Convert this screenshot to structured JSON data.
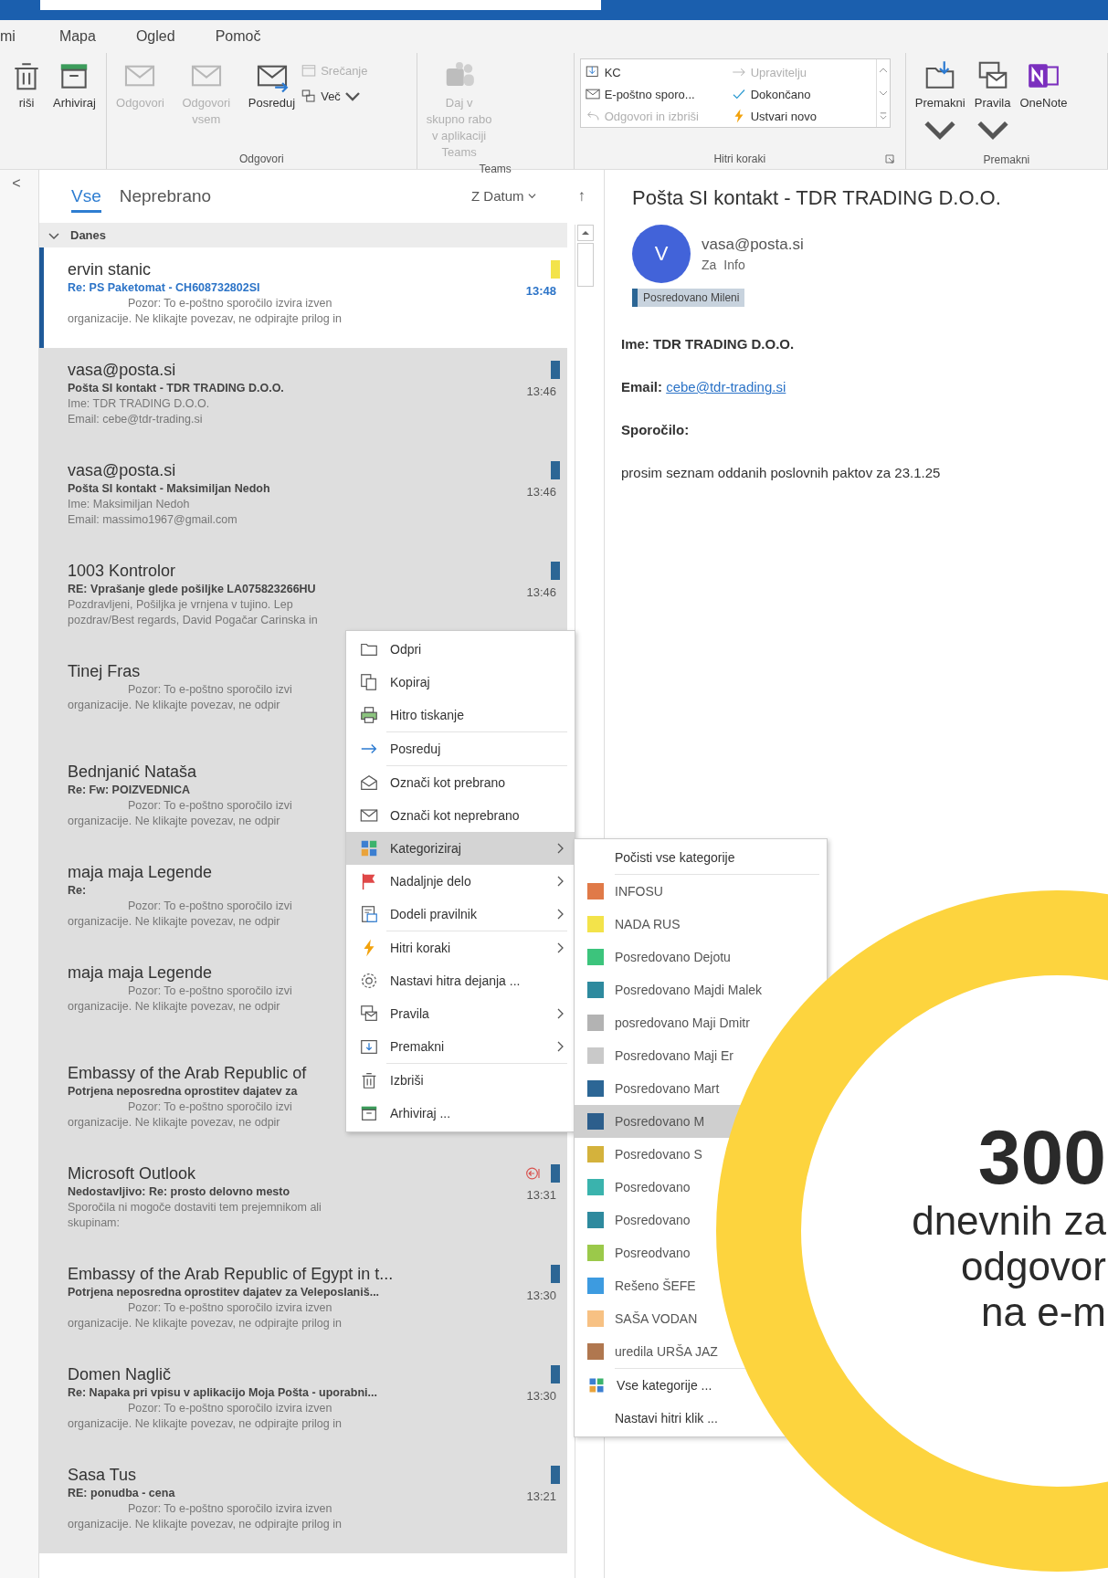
{
  "menu_bar": {
    "items": [
      "mi",
      "Mapa",
      "Ogled",
      "Pomoč"
    ]
  },
  "ribbon": {
    "groups": [
      {
        "buttons": [
          {
            "label": "riši",
            "kind": "large",
            "disabled": false
          },
          {
            "label": "Arhiviraj",
            "kind": "large",
            "disabled": false
          }
        ]
      },
      {
        "label": "Odgovori",
        "buttons": [
          {
            "label": "Odgovori",
            "kind": "large",
            "disabled": true
          },
          {
            "label": "Odgovori vsem",
            "kind": "large",
            "disabled": true
          },
          {
            "label": "Posreduj",
            "kind": "large",
            "disabled": false
          },
          {
            "label": "Srečanje",
            "kind": "small",
            "disabled": true
          },
          {
            "label": "Več",
            "kind": "small",
            "disabled": false,
            "menu": true
          }
        ]
      },
      {
        "label": "Teams",
        "buttons": [
          {
            "label": "Daj v skupno rabo v aplikaciji Teams",
            "kind": "large",
            "disabled": true
          }
        ]
      },
      {
        "label": "Hitri koraki",
        "launcher": true,
        "gallery": [
          {
            "label": "KC",
            "disabled": false
          },
          {
            "label": "E-poštno sporo...",
            "disabled": false
          },
          {
            "label": "Odgovori in izbriši",
            "disabled": true
          },
          {
            "label": "Upravitelju",
            "disabled": true
          },
          {
            "label": "Dokončano",
            "disabled": false
          },
          {
            "label": "Ustvari novo",
            "disabled": false
          }
        ]
      },
      {
        "label": "Premakni",
        "buttons": [
          {
            "label": "Premakni",
            "kind": "large",
            "disabled": false,
            "menu": true
          },
          {
            "label": "Pravila",
            "kind": "large",
            "disabled": false,
            "menu": true
          },
          {
            "label": "OneNote",
            "kind": "large",
            "disabled": false
          }
        ]
      }
    ]
  },
  "nav": {
    "collapse": "<"
  },
  "mail_list": {
    "tabs": [
      {
        "label": "Vse",
        "selected": true
      },
      {
        "label": "Neprebrano",
        "selected": false
      }
    ],
    "sort": "Z Datum",
    "sort_direction": "↑",
    "group": "Danes",
    "items": [
      {
        "sender": "ervin stanic",
        "subject": "Re: PS Paketomat - CH608732802SI",
        "preview": [
          "Pozor: To e-poštno sporočilo izvira izven",
          "organizacije. Ne klikajte povezav, ne odpirajte prilog in"
        ],
        "indented": true,
        "time": "13:48",
        "color": "#f3e34a",
        "selected": true
      },
      {
        "sender": "vasa@posta.si",
        "subject": "Pošta SI kontakt - TDR TRADING D.O.O.",
        "preview": [
          "Ime: TDR TRADING D.O.O.",
          "Email: cebe@tdr-trading.si"
        ],
        "indented": false,
        "time": "13:46",
        "color": "#2c6695",
        "selected": false
      },
      {
        "sender": "vasa@posta.si",
        "subject": "Pošta SI kontakt - Maksimiljan Nedoh",
        "preview": [
          "Ime: Maksimiljan Nedoh",
          "Email: massimo1967@gmail.com"
        ],
        "indented": false,
        "time": "13:46",
        "color": "#2c6695",
        "selected": false
      },
      {
        "sender": "1003 Kontrolor",
        "subject": "RE: Vprašanje glede pošiljke LA075823266HU",
        "preview": [
          "Pozdravljeni,  Pošiljka je vrnjena v tujino.  Lep",
          "pozdrav/Best regards,  David Pogačar  Carinska in"
        ],
        "indented": false,
        "time": "13:46",
        "color": "#2c6695",
        "selected": false
      },
      {
        "sender": "Tinej Fras",
        "preview": [
          "Pozor: To e-poštno sporočilo izvi",
          "organizacije. Ne klikajte povezav, ne odpir"
        ],
        "indented": true,
        "selected": false
      },
      {
        "sender": "Bednjanić Nataša",
        "subject": "Re: Fw: POIZVEDNICA",
        "preview": [
          "Pozor: To e-poštno sporočilo izvi",
          "organizacije. Ne klikajte povezav, ne odpir"
        ],
        "indented": true,
        "selected": false
      },
      {
        "sender": "maja maja Legende",
        "subject": "Re:",
        "preview": [
          "Pozor: To e-poštno sporočilo izvi",
          "organizacije. Ne klikajte povezav, ne odpir"
        ],
        "indented": true,
        "selected": false
      },
      {
        "sender": "maja maja Legende",
        "preview": [
          "Pozor: To e-poštno sporočilo izvi",
          "organizacije. Ne klikajte povezav, ne odpir"
        ],
        "indented": true,
        "selected": false
      },
      {
        "sender": "Embassy of the Arab Republic of",
        "subject": "Potrjena neposredna oprostitev dajatev za",
        "preview": [
          "Pozor: To e-poštno sporočilo izvi",
          "organizacije. Ne klikajte povezav, ne odpir"
        ],
        "indented": true,
        "selected": false
      },
      {
        "sender": "Microsoft Outlook",
        "subject": "Nedostavljivo: Re: prosto delovno mesto",
        "preview": [
          "Sporočila ni mogoče dostaviti tem prejemnikom ali",
          "skupinam:"
        ],
        "indented": false,
        "time": "13:31",
        "color": "#2c6695",
        "undeliverable": true,
        "selected": false
      },
      {
        "sender": "Embassy of the Arab Republic of Egypt in t...",
        "subject": "Potrjena neposredna oprostitev dajatev za Veleposlaniš...",
        "preview": [
          "Pozor: To e-poštno sporočilo izvira izven",
          "organizacije. Ne klikajte povezav, ne odpirajte prilog in"
        ],
        "indented": true,
        "time": "13:30",
        "color": "#2c6695",
        "selected": false
      },
      {
        "sender": "Domen Naglič",
        "subject": "Re: Napaka pri vpisu v aplikacijo Moja Pošta - uporabni...",
        "preview": [
          "Pozor: To e-poštno sporočilo izvira izven",
          "organizacije. Ne klikajte povezav, ne odpirajte prilog in"
        ],
        "indented": true,
        "time": "13:30",
        "color": "#2c6695",
        "selected": false
      },
      {
        "sender": "Sasa Tus",
        "subject": "RE: ponudba - cena",
        "preview": [
          "Pozor: To e-poštno sporočilo izvira izven",
          "organizacije. Ne klikajte povezav, ne odpirajte prilog in"
        ],
        "indented": true,
        "time": "13:21",
        "color": "#2c6695",
        "selected": false
      }
    ]
  },
  "reading_pane": {
    "title": "Pošta SI kontakt - TDR TRADING D.O.O.",
    "avatar": "V",
    "sender": "vasa@posta.si",
    "to_label": "Za",
    "to": "Info",
    "category": {
      "label": "Posredovano Mileni",
      "color": "#2c6695"
    },
    "body": [
      {
        "label": "Ime:",
        "text": "TDR TRADING D.O.O."
      },
      {
        "label": "Email:",
        "link": "cebe@tdr-trading.si"
      },
      {
        "label": "Sporočilo:"
      },
      {
        "text": "prosim seznam oddanih poslovnih paktov za 23.1.25"
      }
    ]
  },
  "context_menu": {
    "items": [
      {
        "label": "Odpri",
        "submenu": false,
        "selected": false,
        "separator_after": false
      },
      {
        "label": "Kopiraj",
        "submenu": false,
        "selected": false,
        "separator_after": false
      },
      {
        "label": "Hitro tiskanje",
        "submenu": false,
        "selected": false,
        "separator_after": true
      },
      {
        "label": "Posreduj",
        "submenu": false,
        "selected": false,
        "separator_after": true
      },
      {
        "label": "Označi kot prebrano",
        "submenu": false,
        "selected": false,
        "separator_after": false
      },
      {
        "label": "Označi kot neprebrano",
        "submenu": false,
        "selected": false,
        "separator_after": false
      },
      {
        "label": "Kategoriziraj",
        "submenu": true,
        "selected": true,
        "separator_after": false
      },
      {
        "label": "Nadaljnje delo",
        "submenu": true,
        "selected": false,
        "separator_after": false
      },
      {
        "label": "Dodeli pravilnik",
        "submenu": true,
        "selected": false,
        "separator_after": true
      },
      {
        "label": "Hitri koraki",
        "submenu": true,
        "selected": false,
        "separator_after": false
      },
      {
        "label": "Nastavi hitra dejanja ...",
        "submenu": false,
        "selected": false,
        "separator_after": false
      },
      {
        "label": "Pravila",
        "submenu": true,
        "selected": false,
        "separator_after": false
      },
      {
        "label": "Premakni",
        "submenu": true,
        "selected": false,
        "separator_after": true
      },
      {
        "label": "Izbriši",
        "submenu": false,
        "selected": false,
        "separator_after": false
      },
      {
        "label": "Arhiviraj ...",
        "submenu": false,
        "selected": false,
        "separator_after": false
      }
    ]
  },
  "category_menu": {
    "items": [
      {
        "kind": "action",
        "label": "Počisti vse kategorije",
        "selected": false,
        "separator_after": true
      },
      {
        "kind": "category",
        "label": "INFOSU",
        "color": "#e07a48",
        "selected": false
      },
      {
        "kind": "category",
        "label": "NADA RUS",
        "color": "#f3e34a",
        "selected": false
      },
      {
        "kind": "category",
        "label": "Posredovano Dejotu",
        "color": "#3cc47c",
        "selected": false
      },
      {
        "kind": "category",
        "label": "Posredovano Majdi Malek",
        "color": "#2e8a9e",
        "selected": false
      },
      {
        "kind": "category",
        "label": "posredovano Maji Dmitr",
        "color": "#b3b3b3",
        "selected": false
      },
      {
        "kind": "category",
        "label": "Posredovano Maji Er",
        "color": "#c9c9c9",
        "selected": false
      },
      {
        "kind": "category",
        "label": "Posredovano Mart",
        "color": "#2c6695",
        "selected": false
      },
      {
        "kind": "category",
        "label": "Posredovano M",
        "color": "#2c5e8c",
        "selected": true
      },
      {
        "kind": "category",
        "label": "Posredovano S",
        "color": "#d4b23c",
        "selected": false
      },
      {
        "kind": "category",
        "label": "Posredovano",
        "color": "#3ab3ad",
        "selected": false
      },
      {
        "kind": "category",
        "label": "Posredovano",
        "color": "#2e8a9e",
        "selected": false
      },
      {
        "kind": "category",
        "label": "Posreodvano",
        "color": "#9bc94a",
        "selected": false
      },
      {
        "kind": "category",
        "label": "Rešeno ŠEFE",
        "color": "#3d9be0",
        "selected": false
      },
      {
        "kind": "category",
        "label": "SAŠA VODAN",
        "color": "#f7c183",
        "selected": false
      },
      {
        "kind": "category",
        "label": "uredila URŠA JAZ",
        "color": "#b0774f",
        "selected": false,
        "separator_after": true
      },
      {
        "kind": "all",
        "label": "Vse kategorije ...",
        "selected": false
      },
      {
        "kind": "action",
        "label": "Nastavi hitri klik ...",
        "selected": false
      }
    ]
  },
  "promo": {
    "number": "300",
    "lines": [
      "dnevnih za",
      "odgovor",
      "na e-m"
    ]
  }
}
